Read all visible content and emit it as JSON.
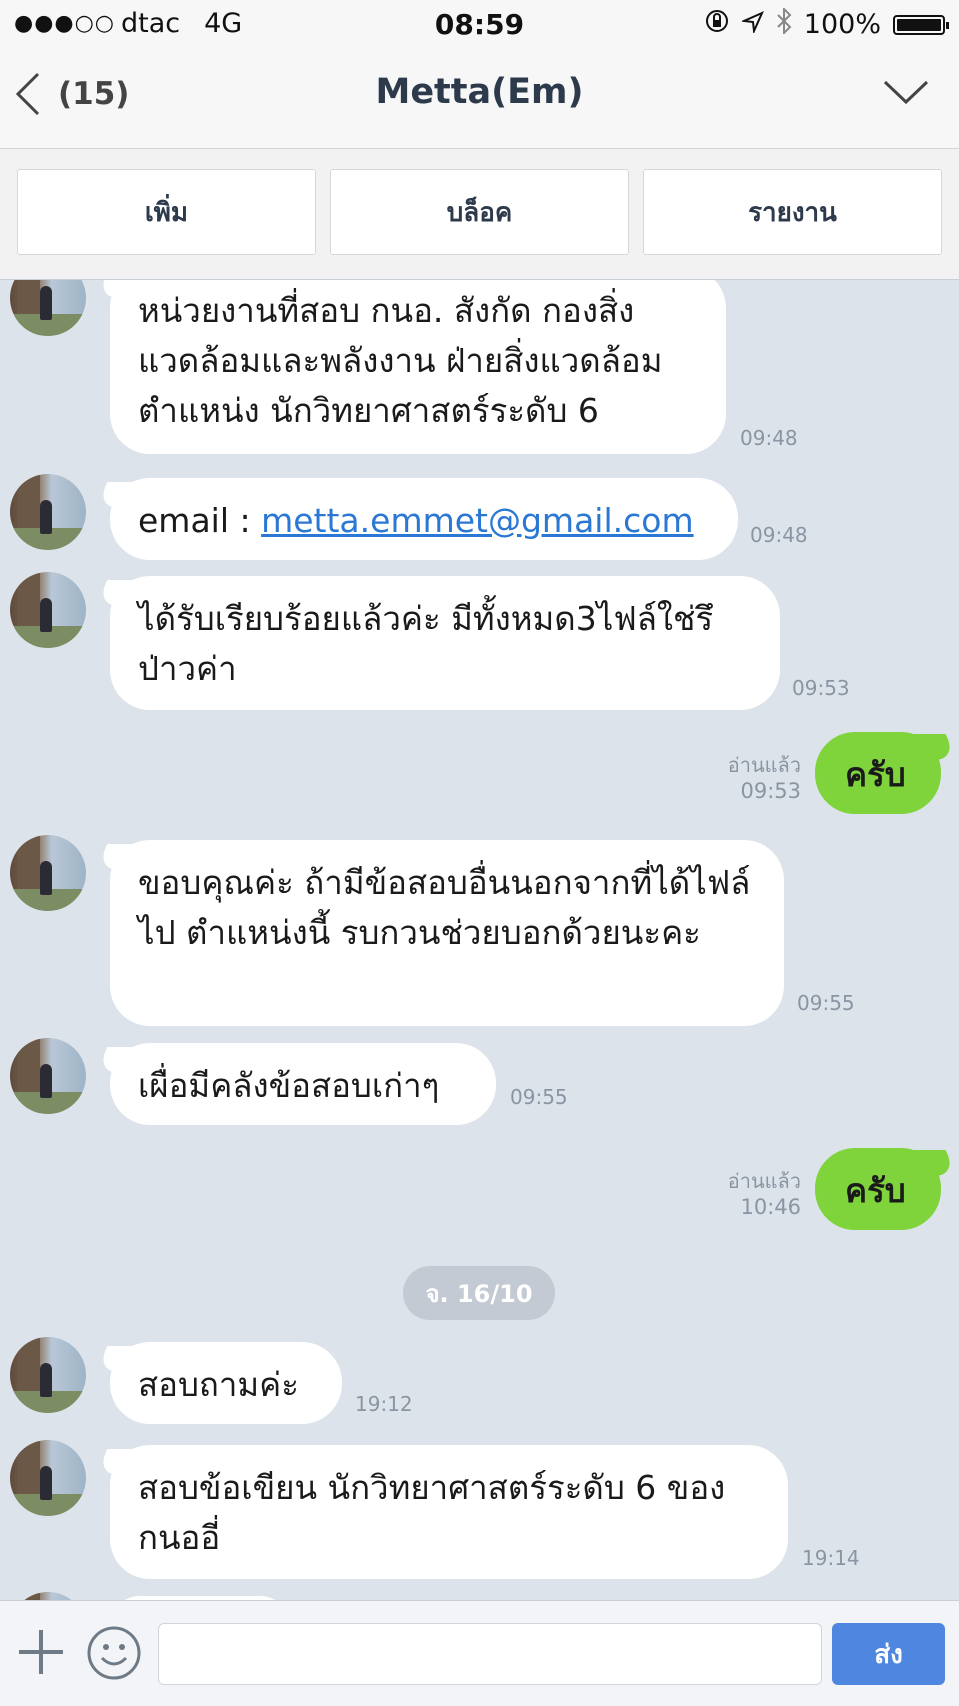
{
  "status_bar": {
    "carrier": "dtac",
    "network": "4G",
    "signal_dots": "●●●○○",
    "time": "08:59",
    "battery": "100%"
  },
  "nav": {
    "back_count": "(15)",
    "title": "Metta(Em)"
  },
  "actions": {
    "add": "เพิ่ม",
    "block": "บล็อค",
    "report": "รายงาน"
  },
  "messages": [
    {
      "from": "in",
      "text": "หน่วยงานที่สอบ กนอ. สังกัด กองสิ่งแวดล้อมและพลังงาน ฝ่ายสิ่งแวดล้อม ตำแหน่ง นักวิทยาศาสตร์ระดับ 6",
      "time": "09:48"
    },
    {
      "from": "in",
      "prefix": "email : ",
      "link": "metta.emmet@gmail.com",
      "time": "09:48"
    },
    {
      "from": "in",
      "text": "ได้รับเรียบร้อยแล้วค่ะ มีทั้งหมด3ไฟล์ใช่รึป่าวค่า",
      "time": "09:53"
    },
    {
      "from": "out",
      "text": "ครับ",
      "read": "อ่านแล้ว",
      "time": "09:53"
    },
    {
      "from": "in",
      "text": "ขอบคุณค่ะ ถ้ามีข้อสอบอื่นนอกจากที่ได้ไฟล์ไป ตำแหน่งนี้ รบกวนช่วยบอกด้วยนะคะ",
      "time": "09:55"
    },
    {
      "from": "in",
      "text": "เผื่อมีคลังข้อสอบเก่าๆ",
      "time": "09:55"
    },
    {
      "from": "out",
      "text": "ครับ",
      "read": "อ่านแล้ว",
      "time": "10:46"
    },
    {
      "from": "in",
      "text": "สอบถามค่ะ",
      "time": "19:12"
    },
    {
      "from": "in",
      "text": "สอบข้อเขียน นักวิทยาศาสตร์ระดับ 6 ของ กนออ​ี่",
      "time": "19:14"
    }
  ],
  "date_divider": "จ. 16/10",
  "input": {
    "placeholder": "",
    "send_label": "ส่ง"
  }
}
